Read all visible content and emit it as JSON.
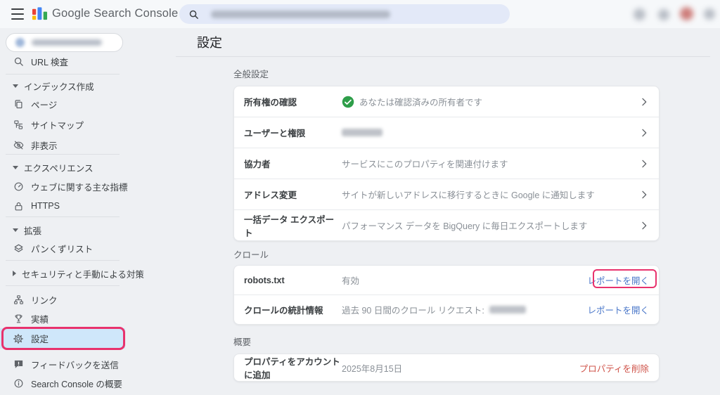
{
  "colors": {
    "annotation_box": "#e8326d",
    "active_item_bg": "#cfe7fa",
    "link_blue": "#4a77c9",
    "delete_red": "#cf5349",
    "verified_green": "#2e9e49",
    "logo_red": "#ea4335",
    "logo_yellow": "#fbbc04",
    "logo_blue": "#4285f4",
    "logo_green": "#34a853"
  },
  "topbar": {
    "app_title": "Google Search Console",
    "icons": [
      "menu-icon",
      "search-icon",
      "blurred-toolbar-icon",
      "blurred-toolbar-icon",
      "blurred-notification-icon",
      "blurred-avatar-icon"
    ]
  },
  "sidebar": {
    "url_inspection": {
      "label": "URL 検査",
      "icon": "search-icon"
    },
    "groups": [
      {
        "header": "インデックス作成",
        "collapsed": false,
        "items": [
          {
            "label": "ページ",
            "icon": "pages-icon"
          },
          {
            "label": "サイトマップ",
            "icon": "sitemap-icon"
          },
          {
            "label": "非表示",
            "icon": "eye-off-icon"
          }
        ]
      },
      {
        "header": "エクスペリエンス",
        "collapsed": false,
        "items": [
          {
            "label": "ウェブに関する主な指標",
            "icon": "gauge-icon"
          },
          {
            "label": "HTTPS",
            "icon": "lock-icon"
          }
        ]
      },
      {
        "header": "拡張",
        "collapsed": false,
        "items": [
          {
            "label": "パンくずリスト",
            "icon": "layers-icon"
          }
        ]
      },
      {
        "header": "セキュリティと手動による対策",
        "collapsed": true,
        "items": []
      }
    ],
    "tools": [
      {
        "label": "リンク",
        "icon": "links-icon"
      },
      {
        "label": "実績",
        "icon": "trophy-icon"
      },
      {
        "label": "設定",
        "icon": "gear-icon",
        "active": true,
        "annotated": true
      }
    ],
    "footer": [
      {
        "label": "フィードバックを送信",
        "icon": "feedback-icon"
      },
      {
        "label": "Search Console の概要",
        "icon": "info-icon"
      }
    ]
  },
  "main": {
    "title": "設定",
    "sections": [
      {
        "header": "全般設定",
        "rows": [
          {
            "label": "所有権の確認",
            "value": "あなたは確認済みの所有者です",
            "value_icon": "verified-check-icon",
            "chevron": true
          },
          {
            "label": "ユーザーと権限",
            "value": "",
            "redacted": true,
            "chevron": true
          },
          {
            "label": "協力者",
            "value": "サービスにこのプロパティを関連付けます",
            "chevron": true
          },
          {
            "label": "アドレス変更",
            "value": "サイトが新しいアドレスに移行するときに Google に通知します",
            "chevron": true
          },
          {
            "label": "一括データ エクスポート",
            "value": "パフォーマンス データを BigQuery に毎日エクスポートします",
            "chevron": true
          }
        ]
      },
      {
        "header": "クロール",
        "rows": [
          {
            "label": "robots.txt",
            "value": "有効",
            "action": "レポートを開く",
            "annotated": true
          },
          {
            "label": "クロールの統計情報",
            "value": "過去 90 日間のクロール リクエスト:",
            "value_redacted_suffix": true,
            "action": "レポートを開く"
          }
        ]
      },
      {
        "header": "概要",
        "rows": [
          {
            "label": "プロパティをアカウントに追加",
            "value": "2025年8月15日",
            "action": "プロパティを削除",
            "action_style": "danger"
          }
        ]
      }
    ]
  }
}
